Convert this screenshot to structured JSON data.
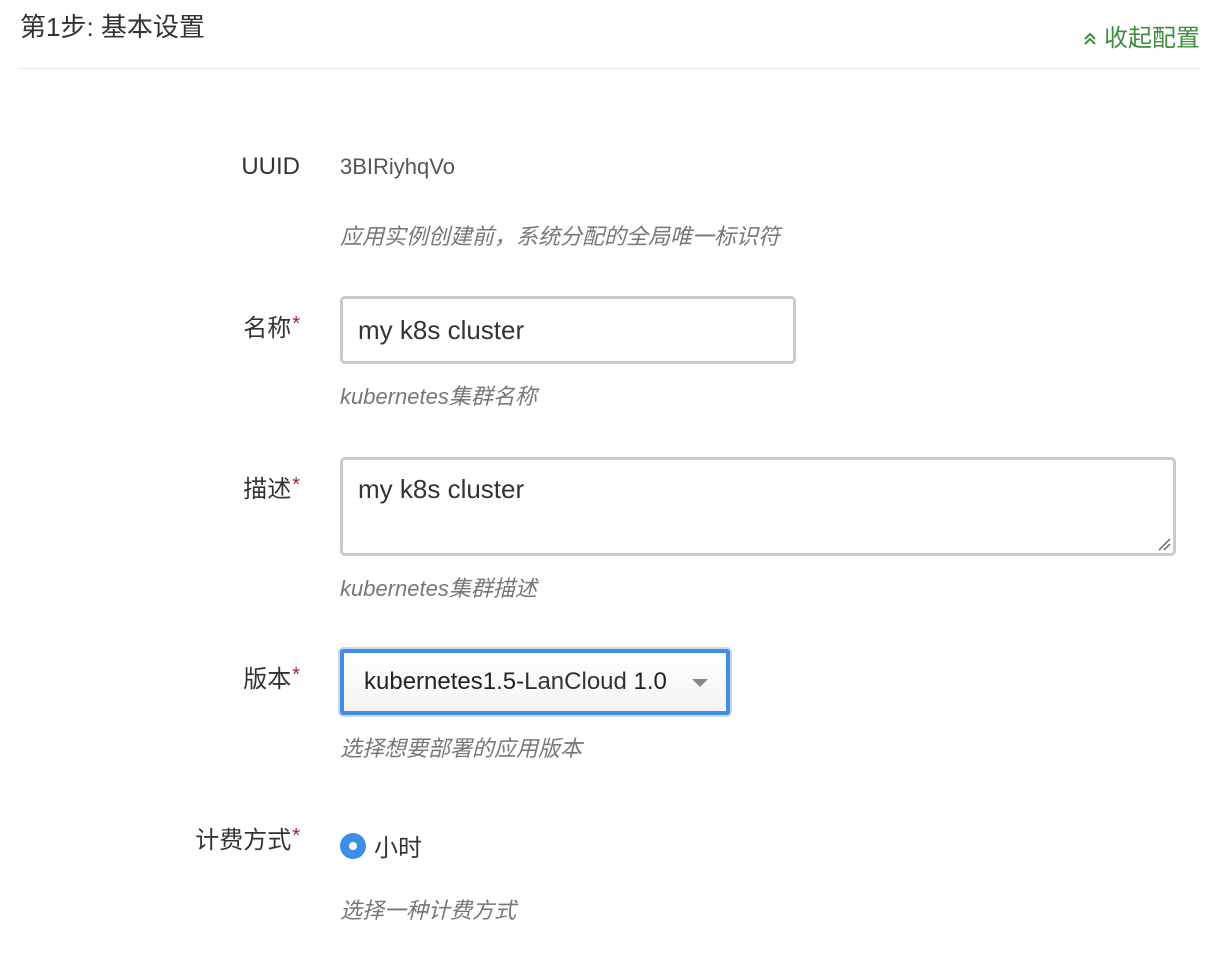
{
  "header": {
    "title": "第1步: 基本设置",
    "collapse_label": "收起配置"
  },
  "form": {
    "uuid": {
      "label": "UUID",
      "value": "3BIRiyhqVo",
      "help": "应用实例创建前，系统分配的全局唯一标识符"
    },
    "name": {
      "label": "名称",
      "required_mark": "*",
      "value": "my k8s cluster",
      "help": "kubernetes集群名称"
    },
    "description": {
      "label": "描述",
      "required_mark": "*",
      "value": "my k8s cluster",
      "help": "kubernetes集群描述"
    },
    "version": {
      "label": "版本",
      "required_mark": "*",
      "selected_prefix": "kubernetes1.5-",
      "selected_brand": "LanCloud",
      "selected_suffix": " 1.0",
      "help": "选择想要部署的应用版本"
    },
    "billing": {
      "label": "计费方式",
      "required_mark": "*",
      "option_label": "小时",
      "selected": true,
      "help": "选择一种计费方式"
    }
  },
  "colors": {
    "accent_blue": "#3e8ee6",
    "link_green": "#3f8c3f",
    "required_red": "#a0262b"
  },
  "icons": {
    "collapse": "double-chevron-up-icon",
    "select_caret": "caret-down-icon",
    "resize": "resize-grip-icon"
  }
}
